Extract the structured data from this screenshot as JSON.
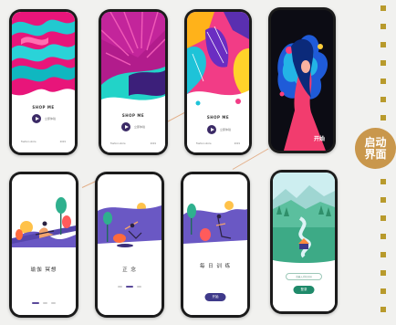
{
  "badge": {
    "line1": "启动",
    "line2": "界面"
  },
  "splash": {
    "brand": "SHOP ME",
    "play_label": "立即体验",
    "foot_left": "Fashion store",
    "foot_right": "2019"
  },
  "onboarding": [
    {
      "title": "瑜伽 冥想",
      "button": ""
    },
    {
      "title": "正 念",
      "button": ""
    },
    {
      "title": "每 日 训 练",
      "button": "开始"
    }
  ],
  "start_label": "开始",
  "login": {
    "field_label": "请输入手机号码",
    "button": "登录"
  },
  "colors": {
    "accent": "#3f3a8a",
    "badge": "#c9974c",
    "squares": "#b89a2c"
  }
}
